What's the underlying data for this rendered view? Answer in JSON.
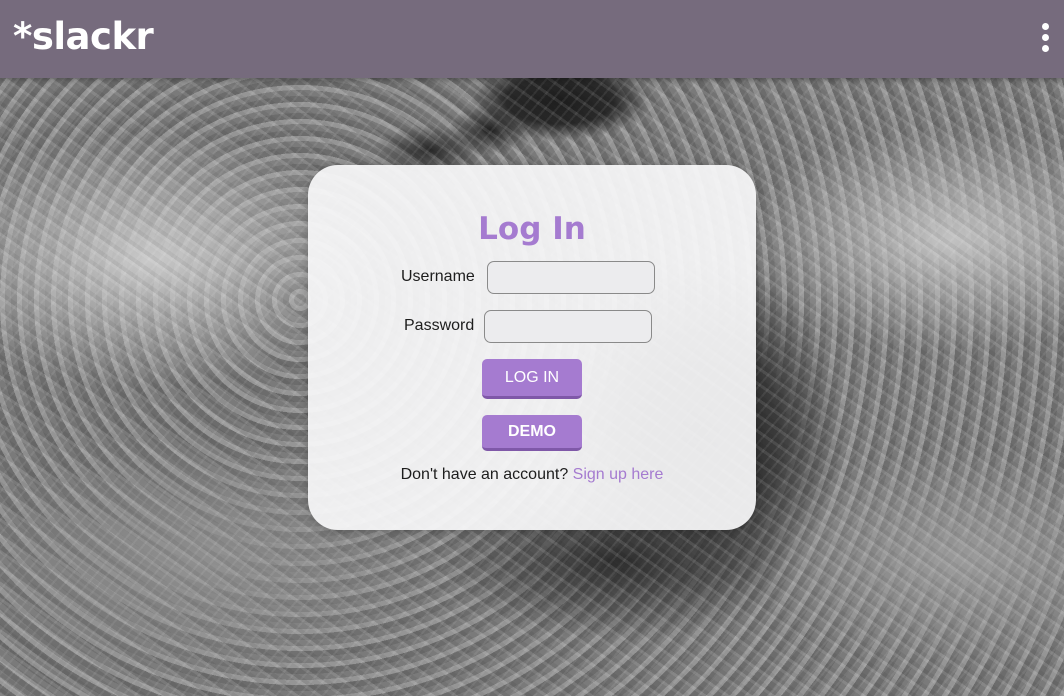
{
  "app": {
    "logo_text": "*slackr",
    "menu_icon": "more-vertical-icon"
  },
  "login": {
    "title": "Log In",
    "username_label": "Username",
    "username_value": "",
    "password_label": "Password",
    "password_value": "",
    "login_button": "LOG IN",
    "demo_button": "DEMO",
    "signup_prompt": "Don't have an account?",
    "signup_link": "Sign up here"
  },
  "colors": {
    "header": "#766b7d",
    "accent": "#a57bd0",
    "card_bg": "#f8f8f9"
  }
}
